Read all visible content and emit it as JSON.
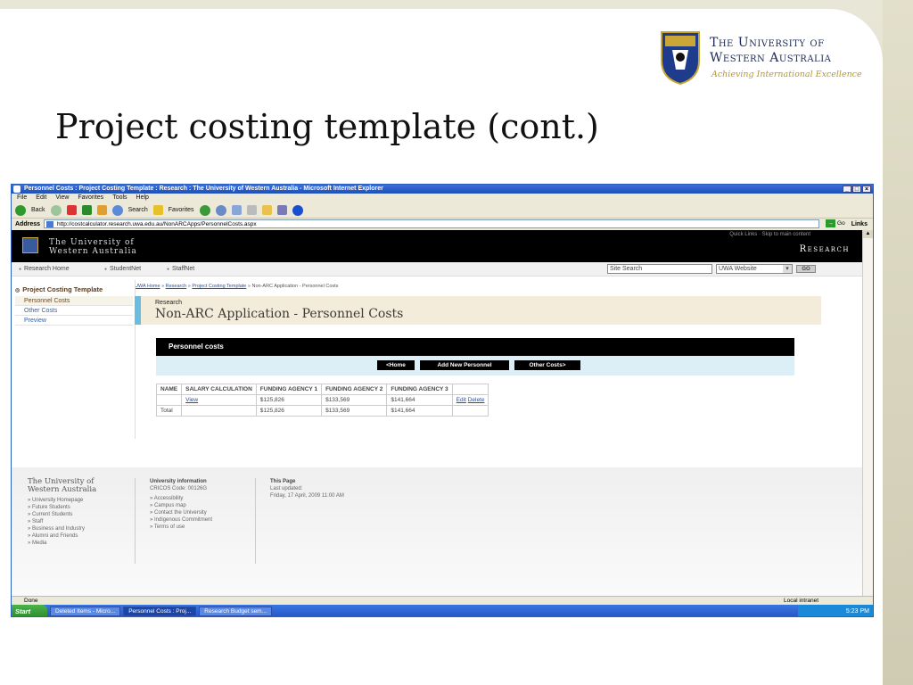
{
  "slide": {
    "title": "Project costing template (cont.)",
    "logo": {
      "line1": "The University of",
      "line2": "Western Australia",
      "motto": "Achieving International Excellence"
    }
  },
  "browser": {
    "window_title": "Personnel Costs : Project Costing Template : Research : The University of Western Australia - Microsoft Internet Explorer",
    "menu": [
      "File",
      "Edit",
      "View",
      "Favorites",
      "Tools",
      "Help"
    ],
    "toolbar": {
      "back": "Back",
      "search": "Search",
      "favorites": "Favorites"
    },
    "address_label": "Address",
    "address": "http://costcalculator.research.uwa.edu.au/NonARCApps/PersonnelCosts.aspx",
    "go": "Go",
    "links": "Links",
    "status": "Done",
    "zone": "Local intranet"
  },
  "site": {
    "uni_line1": "The University of",
    "uni_line2": "Western Australia",
    "quick_links": "Quick Links · Skip to main content",
    "research": "Research",
    "nav": [
      "Research Home",
      "StudentNet",
      "StaffNet"
    ],
    "search_placeholder": "Site Search",
    "search_scope": "UWA Website",
    "search_go": "GO"
  },
  "leftnav": {
    "heading": "Project Costing Template",
    "items": [
      "Personnel Costs",
      "Other Costs",
      "Preview"
    ]
  },
  "breadcrumb": {
    "items": [
      "UWA Home",
      "Research",
      "Project Costing Template"
    ],
    "current": "Non-ARC Application - Personnel Costs",
    "sep": "»"
  },
  "page": {
    "section": "Research",
    "title": "Non-ARC Application - Personnel Costs",
    "panel_title": "Personnel costs",
    "buttons": {
      "home": "<Home",
      "add": "Add New Personnel",
      "other": "Other Costs>"
    }
  },
  "table": {
    "headers": [
      "NAME",
      "SALARY CALCULATION",
      "FUNDING AGENCY 1",
      "FUNDING AGENCY 2",
      "FUNDING AGENCY 3",
      ""
    ],
    "row": {
      "name": "",
      "calc": "View",
      "a1": "$125,826",
      "a2": "$133,569",
      "a3": "$141,664",
      "edit": "Edit",
      "delete": "Delete"
    },
    "total": {
      "label": "Total",
      "a1": "$125,826",
      "a2": "$133,569",
      "a3": "$141,664"
    }
  },
  "footer": {
    "uni_line1": "The University of",
    "uni_line2": "Western Australia",
    "links": [
      "University Homepage",
      "Future Students",
      "Current Students",
      "Staff",
      "Business and Industry",
      "Alumni and Friends",
      "Media"
    ],
    "info_title": "University information",
    "cricos": "CRICOS Code: 00126G",
    "info_links": [
      "Accessibility",
      "Campus map",
      "Contact the University",
      "Indigenous Commitment",
      "Terms of use"
    ],
    "page_title": "This Page",
    "updated_label": "Last updated:",
    "updated": "Friday, 17 April, 2009 11:00 AM"
  },
  "taskbar": {
    "start": "Start",
    "tasks": [
      "Deleted Items - Micro...",
      "Personnel Costs : Proj...",
      "Research Budget sem..."
    ],
    "clock": "5:23 PM"
  }
}
